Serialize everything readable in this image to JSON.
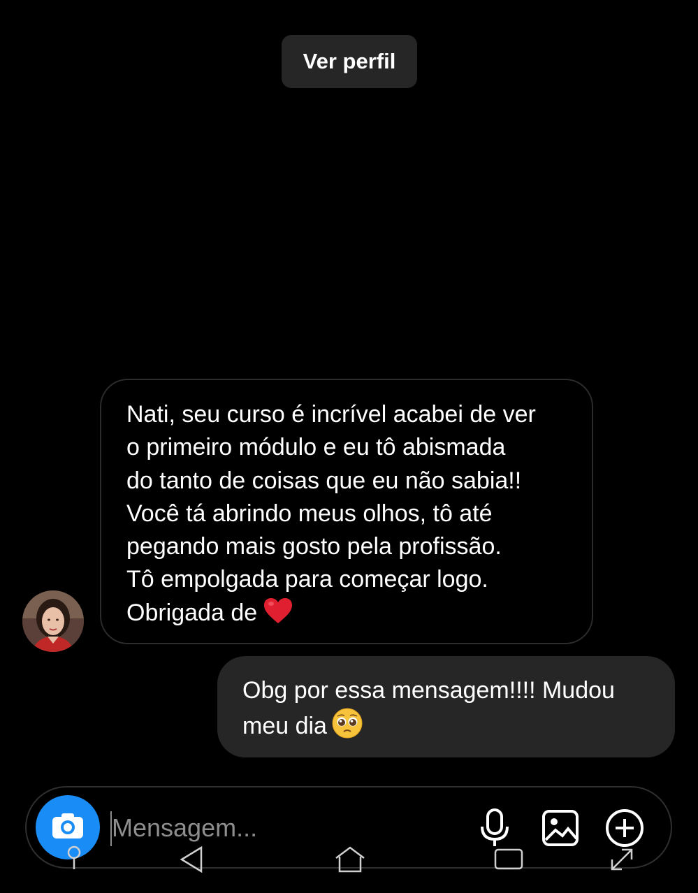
{
  "header": {
    "profile_button_label": "Ver perfil"
  },
  "thread": {
    "incoming": {
      "lines": [
        "Nati, seu curso é incrível acabei de ver",
        "o primeiro módulo e eu tô abismada",
        "do tanto de coisas que eu não sabia!!",
        "Você tá abrindo meus olhos, tô até",
        "pegando mais gosto pela profissão.",
        "Tô empolgada para começar logo.",
        "Obrigada de"
      ],
      "trailing_emoji": "heart-icon"
    },
    "outgoing": {
      "lines": [
        "Obg por essa mensagem!!!! Mudou",
        "meu dia"
      ],
      "trailing_emoji": "pleading-face-icon"
    }
  },
  "composer": {
    "placeholder": "Mensagem...",
    "value": "",
    "icons": [
      "camera-icon",
      "microphone-icon",
      "gallery-icon",
      "plus-circle-icon"
    ]
  },
  "system_nav": {
    "icons": [
      "location-pin-icon",
      "back-icon",
      "home-icon",
      "recents-icon",
      "expand-icon"
    ]
  },
  "colors": {
    "background": "#000000",
    "bubble_outgoing": "#262626",
    "bubble_incoming_border": "#2c2c2c",
    "accent_camera": "#1a8cf5",
    "heart": "#e02030",
    "placeholder": "#8e8e8e"
  }
}
